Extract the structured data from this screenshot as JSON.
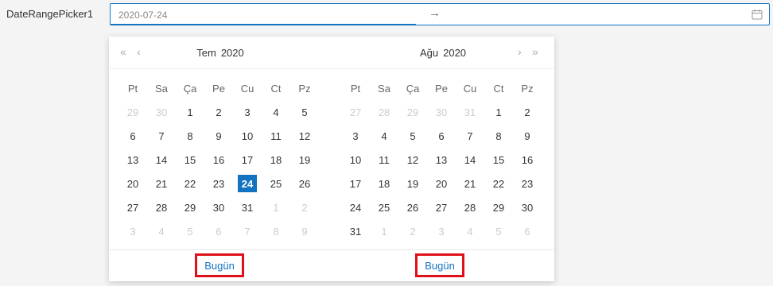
{
  "field": {
    "label": "DateRangePicker1"
  },
  "input": {
    "start_value": "2020-07-24",
    "end_value": "",
    "separator": "→",
    "calendar_icon": "calendar-icon"
  },
  "colors": {
    "accent": "#1273c1",
    "highlight_border": "#e0101a"
  },
  "weekdays": [
    "Pt",
    "Sa",
    "Ça",
    "Pe",
    "Cu",
    "Ct",
    "Pz"
  ],
  "panels": [
    {
      "month": "Tem",
      "year": "2020",
      "nav_prev_year": "«",
      "nav_prev_month": "‹",
      "weeks": [
        [
          {
            "d": "29",
            "m": 1
          },
          {
            "d": "30",
            "m": 1
          },
          {
            "d": "1"
          },
          {
            "d": "2"
          },
          {
            "d": "3"
          },
          {
            "d": "4"
          },
          {
            "d": "5"
          }
        ],
        [
          {
            "d": "6"
          },
          {
            "d": "7"
          },
          {
            "d": "8"
          },
          {
            "d": "9"
          },
          {
            "d": "10"
          },
          {
            "d": "11"
          },
          {
            "d": "12"
          }
        ],
        [
          {
            "d": "13"
          },
          {
            "d": "14"
          },
          {
            "d": "15"
          },
          {
            "d": "16"
          },
          {
            "d": "17"
          },
          {
            "d": "18"
          },
          {
            "d": "19"
          }
        ],
        [
          {
            "d": "20"
          },
          {
            "d": "21"
          },
          {
            "d": "22"
          },
          {
            "d": "23"
          },
          {
            "d": "24",
            "sel": 1
          },
          {
            "d": "25"
          },
          {
            "d": "26"
          }
        ],
        [
          {
            "d": "27"
          },
          {
            "d": "28"
          },
          {
            "d": "29"
          },
          {
            "d": "30"
          },
          {
            "d": "31"
          },
          {
            "d": "1",
            "m": 1
          },
          {
            "d": "2",
            "m": 1
          }
        ],
        [
          {
            "d": "3",
            "m": 1
          },
          {
            "d": "4",
            "m": 1
          },
          {
            "d": "5",
            "m": 1
          },
          {
            "d": "6",
            "m": 1
          },
          {
            "d": "7",
            "m": 1
          },
          {
            "d": "8",
            "m": 1
          },
          {
            "d": "9",
            "m": 1
          }
        ]
      ]
    },
    {
      "month": "Ağu",
      "year": "2020",
      "nav_next_month": "›",
      "nav_next_year": "»",
      "weeks": [
        [
          {
            "d": "27",
            "m": 1
          },
          {
            "d": "28",
            "m": 1
          },
          {
            "d": "29",
            "m": 1
          },
          {
            "d": "30",
            "m": 1
          },
          {
            "d": "31",
            "m": 1
          },
          {
            "d": "1"
          },
          {
            "d": "2"
          }
        ],
        [
          {
            "d": "3"
          },
          {
            "d": "4"
          },
          {
            "d": "5"
          },
          {
            "d": "6"
          },
          {
            "d": "7"
          },
          {
            "d": "8"
          },
          {
            "d": "9"
          }
        ],
        [
          {
            "d": "10"
          },
          {
            "d": "11"
          },
          {
            "d": "12"
          },
          {
            "d": "13"
          },
          {
            "d": "14"
          },
          {
            "d": "15"
          },
          {
            "d": "16"
          }
        ],
        [
          {
            "d": "17"
          },
          {
            "d": "18"
          },
          {
            "d": "19"
          },
          {
            "d": "20"
          },
          {
            "d": "21"
          },
          {
            "d": "22"
          },
          {
            "d": "23"
          }
        ],
        [
          {
            "d": "24"
          },
          {
            "d": "25"
          },
          {
            "d": "26"
          },
          {
            "d": "27"
          },
          {
            "d": "28"
          },
          {
            "d": "29"
          },
          {
            "d": "30"
          }
        ],
        [
          {
            "d": "31"
          },
          {
            "d": "1",
            "m": 1
          },
          {
            "d": "2",
            "m": 1
          },
          {
            "d": "3",
            "m": 1
          },
          {
            "d": "4",
            "m": 1
          },
          {
            "d": "5",
            "m": 1
          },
          {
            "d": "6",
            "m": 1
          }
        ]
      ]
    }
  ],
  "footer": {
    "today_label": "Bugün"
  }
}
